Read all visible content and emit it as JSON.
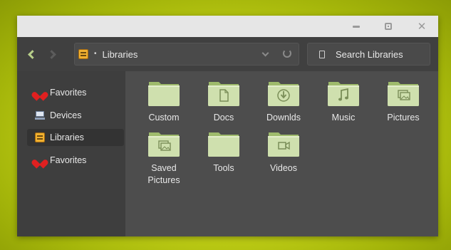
{
  "window": {
    "buttons": {
      "minimize_icon": "minimize-icon",
      "maximize_icon": "maximize-icon",
      "close_icon": "close-icon",
      "close_glyph": "✕"
    }
  },
  "toolbar": {
    "back_icon": "chevron-left-icon",
    "forward_icon": "chevron-right-icon",
    "path": {
      "icon": "libraries-icon",
      "separator": "•",
      "label": "Libraries"
    },
    "search": {
      "placeholder": "Search Libraries"
    }
  },
  "sidebar": {
    "items": [
      {
        "label": "Favorites",
        "icon": "heart-icon",
        "active": false
      },
      {
        "label": "Devices",
        "icon": "monitor-icon",
        "active": false
      },
      {
        "label": "Libraries",
        "icon": "libraries-icon",
        "active": true
      },
      {
        "label": "Favorites",
        "icon": "heart-icon",
        "active": false
      }
    ]
  },
  "folders": [
    {
      "label": "Custom",
      "icon": "folder-icon"
    },
    {
      "label": "Docs",
      "icon": "folder-docs-icon"
    },
    {
      "label": "Downlds",
      "icon": "folder-downloads-icon"
    },
    {
      "label": "Music",
      "icon": "folder-music-icon"
    },
    {
      "label": "Pictures",
      "icon": "folder-pictures-icon"
    },
    {
      "label": "Saved Pictures",
      "icon": "folder-pictures-icon"
    },
    {
      "label": "Tools",
      "icon": "folder-icon"
    },
    {
      "label": "Videos",
      "icon": "folder-videos-icon"
    }
  ],
  "colors": {
    "accent": "#b8cf8a",
    "folder_body": "#cfe0ae",
    "folder_tab": "#9fbb6c",
    "wallpaper": "#c8d61a",
    "heart": "#e02020"
  }
}
